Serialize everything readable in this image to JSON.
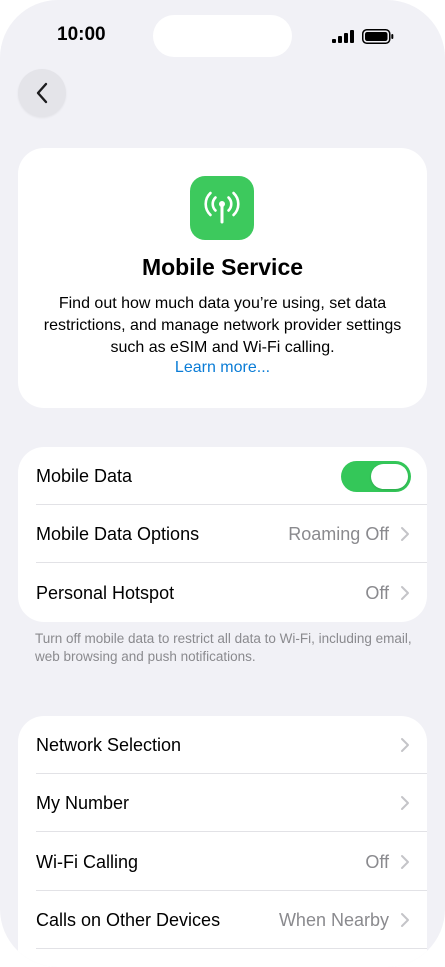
{
  "status_bar": {
    "time": "10:00",
    "signal_icon": "signal-bars-icon",
    "battery_icon": "battery-icon"
  },
  "nav": {
    "back_icon": "chevron-left-icon"
  },
  "header": {
    "icon": "antenna-icon",
    "icon_color": "#3dc95d",
    "title": "Mobile Service",
    "description": "Find out how much data you’re using, set data restrictions, and manage network provider settings such as eSIM and Wi-Fi calling.",
    "link": "Learn more..."
  },
  "data_section": {
    "rows": [
      {
        "label": "Mobile Data",
        "toggle_on": true
      },
      {
        "label": "Mobile Data Options",
        "value": "Roaming Off"
      },
      {
        "label": "Personal Hotspot",
        "value": "Off"
      }
    ],
    "footnote": "Turn off mobile data to restrict all data to Wi-Fi, including email, web browsing and push notifications."
  },
  "network_section": {
    "rows": [
      {
        "label": "Network Selection",
        "value": ""
      },
      {
        "label": "My Number",
        "value": ""
      },
      {
        "label": "Wi-Fi Calling",
        "value": "Off"
      },
      {
        "label": "Calls on Other Devices",
        "value": "When Nearby"
      }
    ]
  },
  "colors": {
    "background": "#f1f1f6",
    "toggle_on": "#34c759",
    "link": "#0a7cd6",
    "secondary_text": "#8a8a8e"
  }
}
